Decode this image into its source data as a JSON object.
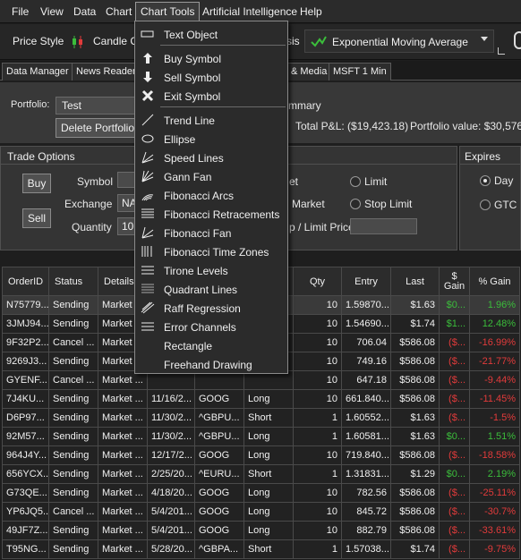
{
  "menubar": {
    "items": [
      "File",
      "View",
      "Data",
      "Chart",
      "Chart Tools",
      "Artificial Intelligence",
      "Help"
    ]
  },
  "toolbar": {
    "price_style_label": "Price Style",
    "price_style_value": "Candle Ch",
    "analysis_label_partial": "sis",
    "indicator_value": "Exponential Moving Average"
  },
  "tabs": [
    "Data Manager",
    "News Reader",
    "& Media",
    "MSFT 1 Min"
  ],
  "portfolio": {
    "label": "Portfolio:",
    "value": "Test",
    "delete_button": "Delete Portfolio",
    "summary_partial": "mmary",
    "total_pl": "Total P&L: ($19,423.18)",
    "portfolio_value": "Portfolio value: $30,576.8"
  },
  "trade_options": {
    "title": "Trade Options",
    "buy": "Buy",
    "sell": "Sell",
    "symbol_label": "Symbol",
    "exchange_label": "Exchange",
    "exchange_value": "NA",
    "quantity_label": "Quantity",
    "quantity_value": "10",
    "market_partial": "et",
    "limit": "Limit",
    "stop_market": "Market",
    "stop_limit": "Stop Limit",
    "price_label": "p / Limit Price"
  },
  "expires": {
    "title": "Expires",
    "day": "Day",
    "gtc": "GTC"
  },
  "orders": {
    "columns": [
      "OrderID",
      "Status",
      "Details",
      "",
      "",
      "",
      "Qty",
      "Entry",
      "Last",
      "$\nGain",
      "% Gain"
    ],
    "rows": [
      [
        "N75779...",
        "Sending",
        "Market ...",
        "",
        "",
        "",
        "10",
        "1.59870...",
        "$1.63",
        "$0...",
        "1.96%"
      ],
      [
        "3JMJ94...",
        "Sending",
        "Market ...",
        "",
        "",
        "",
        "10",
        "1.54690...",
        "$1.74",
        "$1...",
        "12.48%"
      ],
      [
        "9F32P2...",
        "Cancel ...",
        "Market ...",
        "",
        "",
        "",
        "10",
        "706.04",
        "$586.08",
        "($...",
        "-16.99%"
      ],
      [
        "9269J3...",
        "Sending",
        "Market ...",
        "",
        "",
        "",
        "10",
        "749.16",
        "$586.08",
        "($...",
        "-21.77%"
      ],
      [
        "GYENF...",
        "Cancel ...",
        "Market ...",
        "",
        "",
        "",
        "10",
        "647.18",
        "$586.08",
        "($...",
        "-9.44%"
      ],
      [
        "7J4KU...",
        "Sending",
        "Market ...",
        "11/16/2...",
        "GOOG",
        "Long",
        "10",
        "661.840...",
        "$586.08",
        "($...",
        "-11.45%"
      ],
      [
        "D6P97...",
        "Sending",
        "Market ...",
        "11/30/2...",
        "^GBPU...",
        "Short",
        "1",
        "1.60552...",
        "$1.63",
        "($...",
        "-1.5%"
      ],
      [
        "92M57...",
        "Sending",
        "Market ...",
        "11/30/2...",
        "^GBPU...",
        "Long",
        "1",
        "1.60581...",
        "$1.63",
        "$0...",
        "1.51%"
      ],
      [
        "964J4Y...",
        "Sending",
        "Market ...",
        "12/17/2...",
        "GOOG",
        "Long",
        "10",
        "719.840...",
        "$586.08",
        "($...",
        "-18.58%"
      ],
      [
        "656YCX...",
        "Sending",
        "Market ...",
        "2/25/20...",
        "^EURU...",
        "Short",
        "1",
        "1.31831...",
        "$1.29",
        "$0...",
        "2.19%"
      ],
      [
        "G73QE...",
        "Sending",
        "Market ...",
        "4/18/20...",
        "GOOG",
        "Long",
        "10",
        "782.56",
        "$586.08",
        "($...",
        "-25.11%"
      ],
      [
        "YP6JQ5...",
        "Cancel ...",
        "Market ...",
        "5/4/201...",
        "GOOG",
        "Long",
        "10",
        "845.72",
        "$586.08",
        "($...",
        "-30.7%"
      ],
      [
        "49JF7Z...",
        "Sending",
        "Market ...",
        "5/4/201...",
        "GOOG",
        "Long",
        "10",
        "882.79",
        "$586.08",
        "($...",
        "-33.61%"
      ],
      [
        "T95NG...",
        "Sending",
        "Market ...",
        "5/28/20...",
        "^GBPA...",
        "Short",
        "1",
        "1.57038...",
        "$1.74",
        "($...",
        "-9.75%"
      ]
    ],
    "gain_colors": [
      "green",
      "green",
      "red",
      "red",
      "red",
      "red",
      "red",
      "green",
      "red",
      "green",
      "red",
      "red",
      "red",
      "red"
    ]
  },
  "chart_tools_menu": {
    "items": [
      {
        "label": "Text Object",
        "icon": "text-object-icon"
      },
      {
        "label": "Buy Symbol",
        "icon": "up-arrow-icon"
      },
      {
        "label": "Sell Symbol",
        "icon": "down-arrow-icon"
      },
      {
        "label": "Exit Symbol",
        "icon": "x-icon"
      },
      {
        "label": "Trend Line",
        "icon": "trend-line-icon"
      },
      {
        "label": "Ellipse",
        "icon": "ellipse-icon"
      },
      {
        "label": "Speed Lines",
        "icon": "speed-lines-icon"
      },
      {
        "label": "Gann Fan",
        "icon": "gann-fan-icon"
      },
      {
        "label": "Fibonacci Arcs",
        "icon": "fibonacci-arcs-icon"
      },
      {
        "label": "Fibonacci Retracements",
        "icon": "fibonacci-retracements-icon"
      },
      {
        "label": "Fibonacci Fan",
        "icon": "fibonacci-fan-icon"
      },
      {
        "label": "Fibonacci Time Zones",
        "icon": "fibonacci-time-zones-icon"
      },
      {
        "label": "Tirone Levels",
        "icon": "tirone-levels-icon"
      },
      {
        "label": "Quadrant Lines",
        "icon": "quadrant-lines-icon"
      },
      {
        "label": "Raff Regression",
        "icon": "raff-regression-icon"
      },
      {
        "label": "Error Channels",
        "icon": "error-channels-icon"
      },
      {
        "label": "Rectangle",
        "icon": "rectangle-icon"
      },
      {
        "label": "Freehand Drawing",
        "icon": "freehand-drawing-icon"
      }
    ]
  },
  "colors": {
    "gain_positive": "#3bbd3b",
    "gain_negative": "#e23b3b",
    "indicator_green": "#3bbd3b"
  }
}
